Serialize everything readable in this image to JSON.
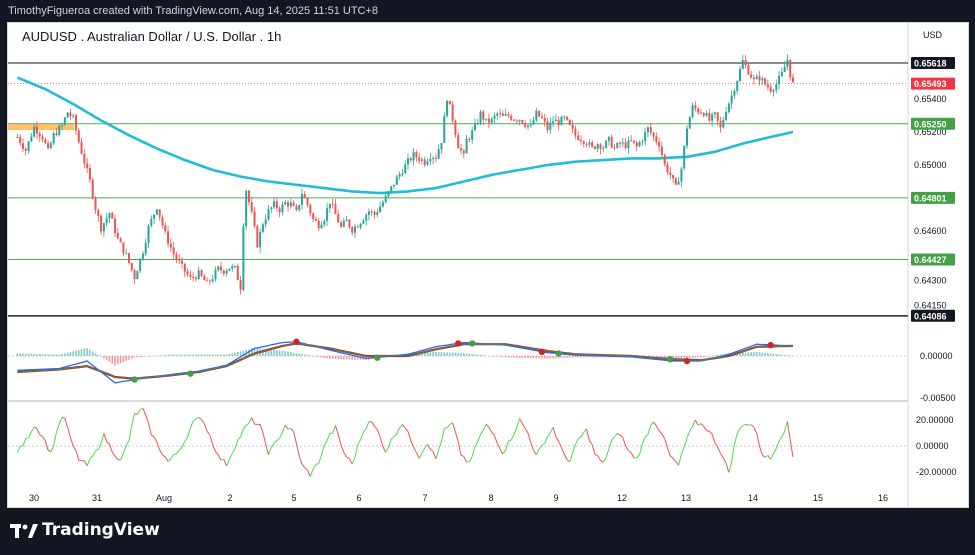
{
  "attribution": "TimothyFigueroa created with TradingView.com, Aug 14, 2025 11:51 UTC+8",
  "brand": "TradingView",
  "colors": {
    "up": "#26a69a",
    "down": "#ef5350",
    "ma": "#22bcd6",
    "hline": "#4caf50",
    "macd_fast": "#2962ff",
    "macd_slow": "#43a047",
    "osc_up": "#4cdb4c",
    "osc_down": "#ef5350"
  },
  "chart_data": {
    "type": "candlestick",
    "title": "AUDUSD . Australian Dollar / U.S. Dollar . 1h",
    "currency": "USD",
    "x_labels": [
      "30",
      "31",
      "Aug",
      "2",
      "5",
      "6",
      "7",
      "8",
      "9",
      "12",
      "13",
      "14",
      "15",
      "16"
    ],
    "y_ticks": [
      0.654,
      0.652,
      0.65,
      0.646,
      0.643,
      0.6415
    ],
    "y_tick_labels": [
      "0.65400",
      "0.65200",
      "0.65000",
      "0.64600",
      "0.64300",
      "0.64150"
    ],
    "price_badges": [
      {
        "label": "0.65618",
        "value": 0.65618,
        "kind": "dark"
      },
      {
        "label": "0.65493",
        "value": 0.65493,
        "kind": "red"
      },
      {
        "label": "0.65250",
        "value": 0.6525,
        "kind": "green"
      },
      {
        "label": "0.64801",
        "value": 0.64801,
        "kind": "green"
      },
      {
        "label": "0.64427",
        "value": 0.64427,
        "kind": "green"
      },
      {
        "label": "0.64086",
        "value": 0.64086,
        "kind": "dark"
      }
    ],
    "horizontal_levels": [
      0.65618,
      0.6525,
      0.64801,
      0.64427,
      0.64086
    ],
    "current_price": 0.65493,
    "price_keypoints": [
      [
        0,
        0.6517
      ],
      [
        3,
        0.6509
      ],
      [
        6,
        0.6523
      ],
      [
        9,
        0.6517
      ],
      [
        11,
        0.6508
      ],
      [
        13,
        0.6518
      ],
      [
        16,
        0.6524
      ],
      [
        18,
        0.6532
      ],
      [
        20,
        0.6528
      ],
      [
        22,
        0.6514
      ],
      [
        24,
        0.6502
      ],
      [
        26,
        0.649
      ],
      [
        28,
        0.6474
      ],
      [
        30,
        0.6462
      ],
      [
        33,
        0.6471
      ],
      [
        36,
        0.6455
      ],
      [
        39,
        0.6445
      ],
      [
        42,
        0.6432
      ],
      [
        45,
        0.6448
      ],
      [
        47,
        0.6462
      ],
      [
        50,
        0.6475
      ],
      [
        53,
        0.6458
      ],
      [
        56,
        0.6446
      ],
      [
        59,
        0.6438
      ],
      [
        62,
        0.6431
      ],
      [
        65,
        0.6434
      ],
      [
        68,
        0.6428
      ],
      [
        70,
        0.6432
      ],
      [
        72,
        0.6437
      ],
      [
        74,
        0.6436
      ],
      [
        76,
        0.6438
      ],
      [
        78,
        0.6437
      ],
      [
        80,
        0.6426
      ],
      [
        81,
        0.6465
      ],
      [
        82,
        0.6485
      ],
      [
        84,
        0.647
      ],
      [
        86,
        0.6452
      ],
      [
        88,
        0.6465
      ],
      [
        90,
        0.6472
      ],
      [
        92,
        0.6476
      ],
      [
        94,
        0.6473
      ],
      [
        96,
        0.6477
      ],
      [
        98,
        0.6476
      ],
      [
        100,
        0.6471
      ],
      [
        102,
        0.6483
      ],
      [
        104,
        0.6476
      ],
      [
        106,
        0.6467
      ],
      [
        108,
        0.6464
      ],
      [
        110,
        0.6468
      ],
      [
        112,
        0.6478
      ],
      [
        114,
        0.647
      ],
      [
        116,
        0.6462
      ],
      [
        118,
        0.6466
      ],
      [
        120,
        0.6461
      ],
      [
        122,
        0.6464
      ],
      [
        124,
        0.6468
      ],
      [
        126,
        0.6472
      ],
      [
        128,
        0.647
      ],
      [
        130,
        0.6475
      ],
      [
        132,
        0.648
      ],
      [
        134,
        0.6486
      ],
      [
        136,
        0.6492
      ],
      [
        138,
        0.6497
      ],
      [
        140,
        0.6502
      ],
      [
        142,
        0.6506
      ],
      [
        144,
        0.6504
      ],
      [
        146,
        0.6502
      ],
      [
        148,
        0.6506
      ],
      [
        150,
        0.6505
      ],
      [
        152,
        0.6515
      ],
      [
        154,
        0.6541
      ],
      [
        156,
        0.6528
      ],
      [
        158,
        0.6512
      ],
      [
        160,
        0.6505
      ],
      [
        161,
        0.6515
      ],
      [
        162,
        0.6517
      ],
      [
        164,
        0.6523
      ],
      [
        166,
        0.6531
      ],
      [
        168,
        0.6526
      ],
      [
        170,
        0.6527
      ],
      [
        172,
        0.6531
      ],
      [
        174,
        0.6529
      ],
      [
        176,
        0.653
      ],
      [
        178,
        0.6528
      ],
      [
        180,
        0.6528
      ],
      [
        182,
        0.6525
      ],
      [
        184,
        0.6523
      ],
      [
        186,
        0.6531
      ],
      [
        188,
        0.6528
      ],
      [
        190,
        0.6522
      ],
      [
        192,
        0.6527
      ],
      [
        194,
        0.6526
      ],
      [
        196,
        0.6528
      ],
      [
        198,
        0.6523
      ],
      [
        200,
        0.6518
      ],
      [
        202,
        0.6516
      ],
      [
        204,
        0.6514
      ],
      [
        206,
        0.651
      ],
      [
        208,
        0.6513
      ],
      [
        210,
        0.6511
      ],
      [
        212,
        0.6515
      ],
      [
        214,
        0.651
      ],
      [
        216,
        0.6513
      ],
      [
        218,
        0.6512
      ],
      [
        220,
        0.6514
      ],
      [
        222,
        0.6511
      ],
      [
        224,
        0.6516
      ],
      [
        226,
        0.6522
      ],
      [
        228,
        0.6517
      ],
      [
        230,
        0.6513
      ],
      [
        232,
        0.65
      ],
      [
        234,
        0.6494
      ],
      [
        236,
        0.6486
      ],
      [
        238,
        0.6498
      ],
      [
        240,
        0.6523
      ],
      [
        242,
        0.6535
      ],
      [
        244,
        0.6533
      ],
      [
        246,
        0.6532
      ],
      [
        248,
        0.6527
      ],
      [
        250,
        0.653
      ],
      [
        252,
        0.6522
      ],
      [
        254,
        0.6534
      ],
      [
        256,
        0.6542
      ],
      [
        258,
        0.6552
      ],
      [
        260,
        0.6563
      ],
      [
        262,
        0.6557
      ],
      [
        264,
        0.6551
      ],
      [
        266,
        0.6553
      ],
      [
        268,
        0.6549
      ],
      [
        270,
        0.6546
      ],
      [
        272,
        0.6549
      ],
      [
        274,
        0.6555
      ],
      [
        276,
        0.6564
      ],
      [
        277,
        0.6555
      ],
      [
        278,
        0.6549
      ]
    ],
    "moving_average_keypoints": [
      [
        0,
        0.6553
      ],
      [
        10,
        0.6546
      ],
      [
        20,
        0.6537
      ],
      [
        30,
        0.6527
      ],
      [
        40,
        0.6518
      ],
      [
        50,
        0.651
      ],
      [
        60,
        0.6503
      ],
      [
        70,
        0.6497
      ],
      [
        80,
        0.6493
      ],
      [
        90,
        0.649
      ],
      [
        100,
        0.6488
      ],
      [
        110,
        0.6486
      ],
      [
        120,
        0.6484
      ],
      [
        130,
        0.6483
      ],
      [
        140,
        0.6484
      ],
      [
        150,
        0.6486
      ],
      [
        160,
        0.649
      ],
      [
        170,
        0.6494
      ],
      [
        180,
        0.6497
      ],
      [
        190,
        0.65
      ],
      [
        200,
        0.6502
      ],
      [
        210,
        0.6503
      ],
      [
        220,
        0.6504
      ],
      [
        230,
        0.6504
      ],
      [
        240,
        0.6505
      ],
      [
        250,
        0.6508
      ],
      [
        260,
        0.6513
      ],
      [
        270,
        0.6517
      ],
      [
        278,
        0.652
      ]
    ],
    "macd": {
      "y_labels": [
        "0.00000",
        "-0.00500"
      ],
      "y_values": [
        0,
        -0.005
      ],
      "fast_keypoints": [
        [
          0,
          -0.0017
        ],
        [
          15,
          -0.0015
        ],
        [
          25,
          -0.0006
        ],
        [
          35,
          -0.0032
        ],
        [
          42,
          -0.0028
        ],
        [
          55,
          -0.0022
        ],
        [
          65,
          -0.0018
        ],
        [
          75,
          -0.0011
        ],
        [
          85,
          0.0009
        ],
        [
          95,
          0.0016
        ],
        [
          100,
          0.0017
        ],
        [
          112,
          0.0007
        ],
        [
          125,
          -0.0003
        ],
        [
          140,
          0.0002
        ],
        [
          150,
          0.0011
        ],
        [
          160,
          0.0016
        ],
        [
          175,
          0.0013
        ],
        [
          190,
          0.0004
        ],
        [
          200,
          0.0001
        ],
        [
          220,
          -0.0001
        ],
        [
          235,
          -0.0006
        ],
        [
          245,
          -0.0006
        ],
        [
          255,
          0.0002
        ],
        [
          265,
          0.0014
        ],
        [
          278,
          0.0012
        ]
      ],
      "slow_keypoints": [
        [
          0,
          -0.0019
        ],
        [
          15,
          -0.0016
        ],
        [
          25,
          -0.0012
        ],
        [
          35,
          -0.0025
        ],
        [
          42,
          -0.0027
        ],
        [
          55,
          -0.0023
        ],
        [
          65,
          -0.0019
        ],
        [
          75,
          -0.0012
        ],
        [
          85,
          0.0003
        ],
        [
          95,
          0.0012
        ],
        [
          100,
          0.0015
        ],
        [
          112,
          0.0009
        ],
        [
          125,
          0.0
        ],
        [
          140,
          0.0
        ],
        [
          150,
          0.0008
        ],
        [
          160,
          0.0014
        ],
        [
          175,
          0.0014
        ],
        [
          190,
          0.0006
        ],
        [
          200,
          0.0002
        ],
        [
          220,
          0.0
        ],
        [
          235,
          -0.0004
        ],
        [
          245,
          -0.0005
        ],
        [
          255,
          0.0
        ],
        [
          265,
          0.0011
        ],
        [
          278,
          0.0012
        ]
      ],
      "cross_markers": [
        [
          42,
          -0.0028,
          "up"
        ],
        [
          62,
          -0.0021,
          "up"
        ],
        [
          100,
          0.0017,
          "down"
        ],
        [
          129,
          -0.0002,
          "up"
        ],
        [
          158,
          0.0015,
          "down"
        ],
        [
          163,
          0.0015,
          "up"
        ],
        [
          188,
          0.0005,
          "down"
        ],
        [
          194,
          0.0003,
          "up"
        ],
        [
          234,
          -0.0004,
          "up"
        ],
        [
          240,
          -0.0006,
          "down"
        ],
        [
          270,
          0.0013,
          "down"
        ]
      ]
    },
    "oscillator": {
      "y_labels": [
        "20.00000",
        "0.00000",
        "-20.00000"
      ],
      "y_values": [
        20,
        0,
        -20
      ],
      "keypoints": [
        [
          0,
          -5
        ],
        [
          3,
          4
        ],
        [
          6,
          16
        ],
        [
          9,
          8
        ],
        [
          12,
          -6
        ],
        [
          15,
          18
        ],
        [
          17,
          22
        ],
        [
          19,
          5
        ],
        [
          22,
          -10
        ],
        [
          25,
          -15
        ],
        [
          28,
          -5
        ],
        [
          31,
          8
        ],
        [
          34,
          -3
        ],
        [
          37,
          -12
        ],
        [
          40,
          5
        ],
        [
          42,
          24
        ],
        [
          45,
          28
        ],
        [
          48,
          10
        ],
        [
          51,
          -2
        ],
        [
          54,
          -12
        ],
        [
          57,
          -6
        ],
        [
          60,
          4
        ],
        [
          63,
          18
        ],
        [
          66,
          22
        ],
        [
          69,
          8
        ],
        [
          72,
          -8
        ],
        [
          75,
          -14
        ],
        [
          78,
          0
        ],
        [
          81,
          12
        ],
        [
          84,
          20
        ],
        [
          87,
          15
        ],
        [
          90,
          -5
        ],
        [
          93,
          3
        ],
        [
          96,
          16
        ],
        [
          99,
          10
        ],
        [
          102,
          -15
        ],
        [
          105,
          -22
        ],
        [
          108,
          -12
        ],
        [
          111,
          5
        ],
        [
          114,
          14
        ],
        [
          117,
          -5
        ],
        [
          120,
          -14
        ],
        [
          123,
          6
        ],
        [
          126,
          20
        ],
        [
          129,
          12
        ],
        [
          132,
          -4
        ],
        [
          135,
          8
        ],
        [
          138,
          18
        ],
        [
          141,
          5
        ],
        [
          144,
          -8
        ],
        [
          147,
          3
        ],
        [
          150,
          -10
        ],
        [
          153,
          12
        ],
        [
          156,
          17
        ],
        [
          159,
          -6
        ],
        [
          162,
          -14
        ],
        [
          165,
          4
        ],
        [
          168,
          16
        ],
        [
          171,
          8
        ],
        [
          174,
          -5
        ],
        [
          177,
          6
        ],
        [
          180,
          20
        ],
        [
          183,
          10
        ],
        [
          186,
          -8
        ],
        [
          189,
          4
        ],
        [
          192,
          14
        ],
        [
          195,
          -3
        ],
        [
          198,
          -12
        ],
        [
          201,
          5
        ],
        [
          204,
          12
        ],
        [
          207,
          -6
        ],
        [
          210,
          -14
        ],
        [
          213,
          4
        ],
        [
          216,
          10
        ],
        [
          219,
          -4
        ],
        [
          222,
          -10
        ],
        [
          225,
          6
        ],
        [
          228,
          20
        ],
        [
          231,
          10
        ],
        [
          234,
          -8
        ],
        [
          237,
          -15
        ],
        [
          240,
          6
        ],
        [
          243,
          18
        ],
        [
          246,
          16
        ],
        [
          249,
          8
        ],
        [
          252,
          -4
        ],
        [
          255,
          -20
        ],
        [
          258,
          10
        ],
        [
          261,
          18
        ],
        [
          264,
          15
        ],
        [
          267,
          -6
        ],
        [
          270,
          -10
        ],
        [
          273,
          5
        ],
        [
          276,
          17
        ],
        [
          278,
          -8
        ]
      ]
    }
  }
}
